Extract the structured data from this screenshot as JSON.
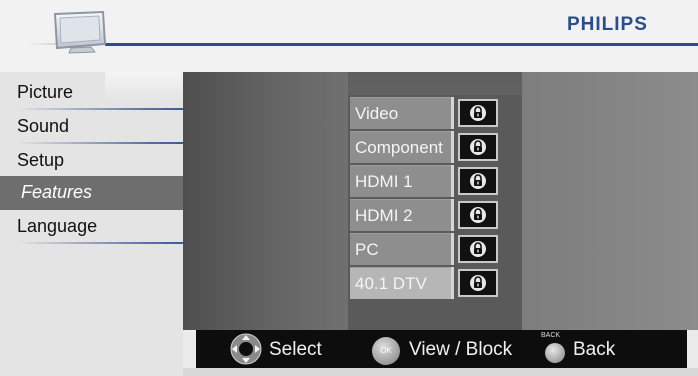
{
  "header": {
    "brand": "PHILIPS",
    "tv_icon": "tv-icon"
  },
  "menu": {
    "items": [
      {
        "label": "Picture",
        "selected": false
      },
      {
        "label": "Sound",
        "selected": false
      },
      {
        "label": "Setup",
        "selected": false
      },
      {
        "label": "Features",
        "selected": true
      },
      {
        "label": "Language",
        "selected": false
      }
    ]
  },
  "block_list": {
    "rows": [
      {
        "label": "Video",
        "icon": "lock-icon"
      },
      {
        "label": "Component",
        "icon": "lock-icon"
      },
      {
        "label": "HDMI 1",
        "icon": "lock-icon"
      },
      {
        "label": "HDMI 2",
        "icon": "lock-icon"
      },
      {
        "label": "PC",
        "icon": "lock-icon"
      },
      {
        "label": "40.1 DTV",
        "icon": "lock-icon",
        "selected": true
      }
    ]
  },
  "help": {
    "select_label": "Select",
    "ok_icon_text": "OK",
    "view_label": "View / Block",
    "back_small": "BACK",
    "back_label": "Back"
  },
  "colors": {
    "brand_blue": "#2b4c8e",
    "selected_menu_bg": "#6e6e6e",
    "helpbar_bg": "#0d0d0d"
  }
}
